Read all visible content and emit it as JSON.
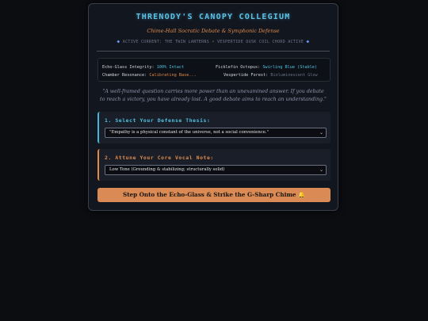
{
  "header": {
    "title": "THRENODY'S CANOPY COLLEGIUM",
    "subtitle": "Chime-Hall Socratic Debate & Symphonic Defense",
    "current_text": "ACTIVE CURRENT: THE TWIN LANTERNS • VESPERTIDE DUSK COIL CHORD ACTIVE",
    "gem_glyph": "◆"
  },
  "status": {
    "echo_glass_label": "Echo-Glass Integrity:",
    "echo_glass_value": "100% Intact",
    "ficklefin_label": "Ficklefin Octopus:",
    "ficklefin_value": "Swirling Blue (Stable)",
    "chamber_label": "Chamber Resonance:",
    "chamber_value": "Calibrating Base...",
    "forest_label": "Vespertide Forest:",
    "forest_value": "Bioluminescent Glow"
  },
  "quote": "\"A well-framed question carries more power than an unexamined answer. If you debate to reach a victory, you have already lost. A good debate aims to reach an understanding.\"",
  "thesis": {
    "label": "1. Select Your Defense Thesis:",
    "selected": "\"Empathy is a physical constant of the universe, not a social convenience.\""
  },
  "vocal": {
    "label": "2. Attune Your Core Vocal Note:",
    "selected": "Low Tone (Grounding & stabilizing; structurally solid)"
  },
  "cta": {
    "label": "Step Onto the Echo-Glass & Strike the G-Sharp Chime",
    "bell": "🔔"
  },
  "colors": {
    "accent_cyan": "#4fc3e3",
    "accent_orange": "#e08a4a",
    "button_bg": "#d98a55"
  }
}
